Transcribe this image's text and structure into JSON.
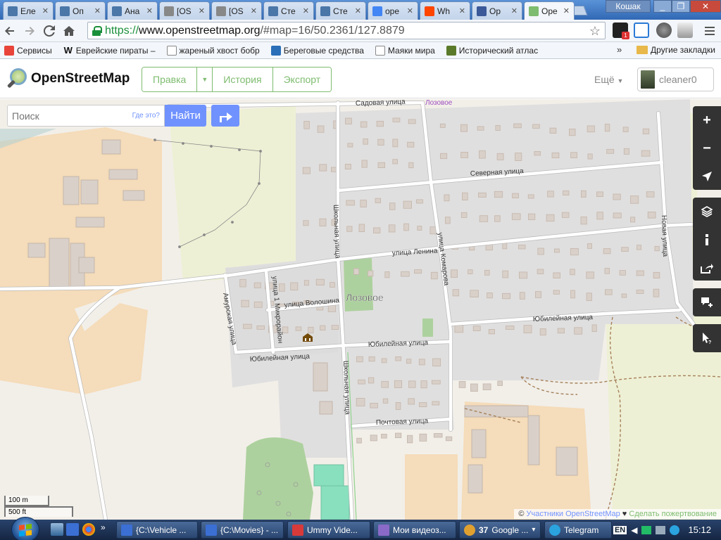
{
  "browser": {
    "tabs": [
      {
        "title": "Еле",
        "icon": "vk-icon",
        "color": "#4a76a8"
      },
      {
        "title": "Оп",
        "icon": "vk-icon",
        "color": "#4a76a8"
      },
      {
        "title": "Ана",
        "icon": "vk-icon",
        "color": "#4a76a8"
      },
      {
        "title": "[OS",
        "icon": "page-icon",
        "color": "#888888"
      },
      {
        "title": "[OS",
        "icon": "page-icon",
        "color": "#888888"
      },
      {
        "title": "Сте",
        "icon": "vk-icon",
        "color": "#4a76a8"
      },
      {
        "title": "Сте",
        "icon": "vk-icon",
        "color": "#4a76a8"
      },
      {
        "title": "ope",
        "icon": "google-icon",
        "color": "#4285f4"
      },
      {
        "title": "Wh",
        "icon": "reddit-icon",
        "color": "#ff4500"
      },
      {
        "title": "Оp",
        "icon": "facebook-icon",
        "color": "#3b5998"
      },
      {
        "title": "Ope",
        "icon": "osm-icon",
        "color": "#7ebc6f"
      }
    ],
    "window_user": "Кошак",
    "url_secure": "https://",
    "url_host": "www.openstreetmap.org",
    "url_rest": "/#map=16/50.2361/127.8879",
    "bookmarks": [
      {
        "label": "Сервисы",
        "icon": "apps-grid-icon"
      },
      {
        "label": "Еврейские пираты –",
        "icon": "wikipedia-icon"
      },
      {
        "label": "жареный хвост бобр",
        "icon": "page-icon"
      },
      {
        "label": "Береговые средства",
        "icon": "site-icon"
      },
      {
        "label": "Маяки мира",
        "icon": "page-icon"
      },
      {
        "label": "Исторический атлас",
        "icon": "atlas-icon"
      }
    ],
    "other_bookmarks": "Другие закладки",
    "bookmarks_overflow": "»"
  },
  "osm": {
    "logo_text": "OpenStreetMap",
    "nav": {
      "edit": "Правка",
      "history": "История",
      "export": "Экспорт"
    },
    "more": "Ещё",
    "user": "cleaner0",
    "search_placeholder": "Поиск",
    "where_is_this": "Где это?",
    "find_button": "Найти",
    "map_controls": [
      "+",
      "−",
      "locate",
      "layers",
      "info",
      "share",
      "note",
      "query"
    ],
    "scale": {
      "metric": "100 m",
      "imperial": "500 ft"
    },
    "attribution": {
      "copyright": "© ",
      "contributors": "Участники OpenStreetMap",
      "heart": " ♥ ",
      "donate": "Сделать пожертвование"
    },
    "map_labels": {
      "village": "Лозовое",
      "village_small": "Лозовое",
      "streets": {
        "sadovaya": "Садовая улица",
        "severnaya": "Северная улица",
        "lenina": "улица Ленина",
        "shkolnaya_top": "Школьная улица",
        "shkolnaya_bottom": "Школьная улица",
        "komarova": "улица Комарова",
        "novaya": "Новая улица",
        "amurskaya": "Амурская улица",
        "mikrorayon": "улица 1 Микрорайон",
        "voloshina": "улица Волошина",
        "yubil_1": "Юбилейная улица",
        "yubil_2": "Юбилейная улица",
        "yubil_3": "Юбилейная улица",
        "pochtovaya": "Почтовая улица"
      }
    }
  },
  "taskbar": {
    "items": [
      {
        "label": "{C:\\Vehicle ...",
        "icon": "folder-doc-icon",
        "color": "#3b6fd4"
      },
      {
        "label": "{C:\\Movies} - ...",
        "icon": "folder-doc-icon",
        "color": "#3b6fd4"
      },
      {
        "label": "Ummy Vide...",
        "icon": "download-icon",
        "color": "#d83a3a"
      },
      {
        "label": "Мои видеоз...",
        "icon": "archive-icon",
        "color": "#8a6ac8"
      },
      {
        "label": "Google ...",
        "icon": "chrome-icon",
        "color": "#e0a030",
        "badge": "37"
      },
      {
        "label": "Telegram",
        "icon": "telegram-icon",
        "color": "#2aa3df"
      }
    ],
    "lang": "EN",
    "time": "15:12"
  }
}
